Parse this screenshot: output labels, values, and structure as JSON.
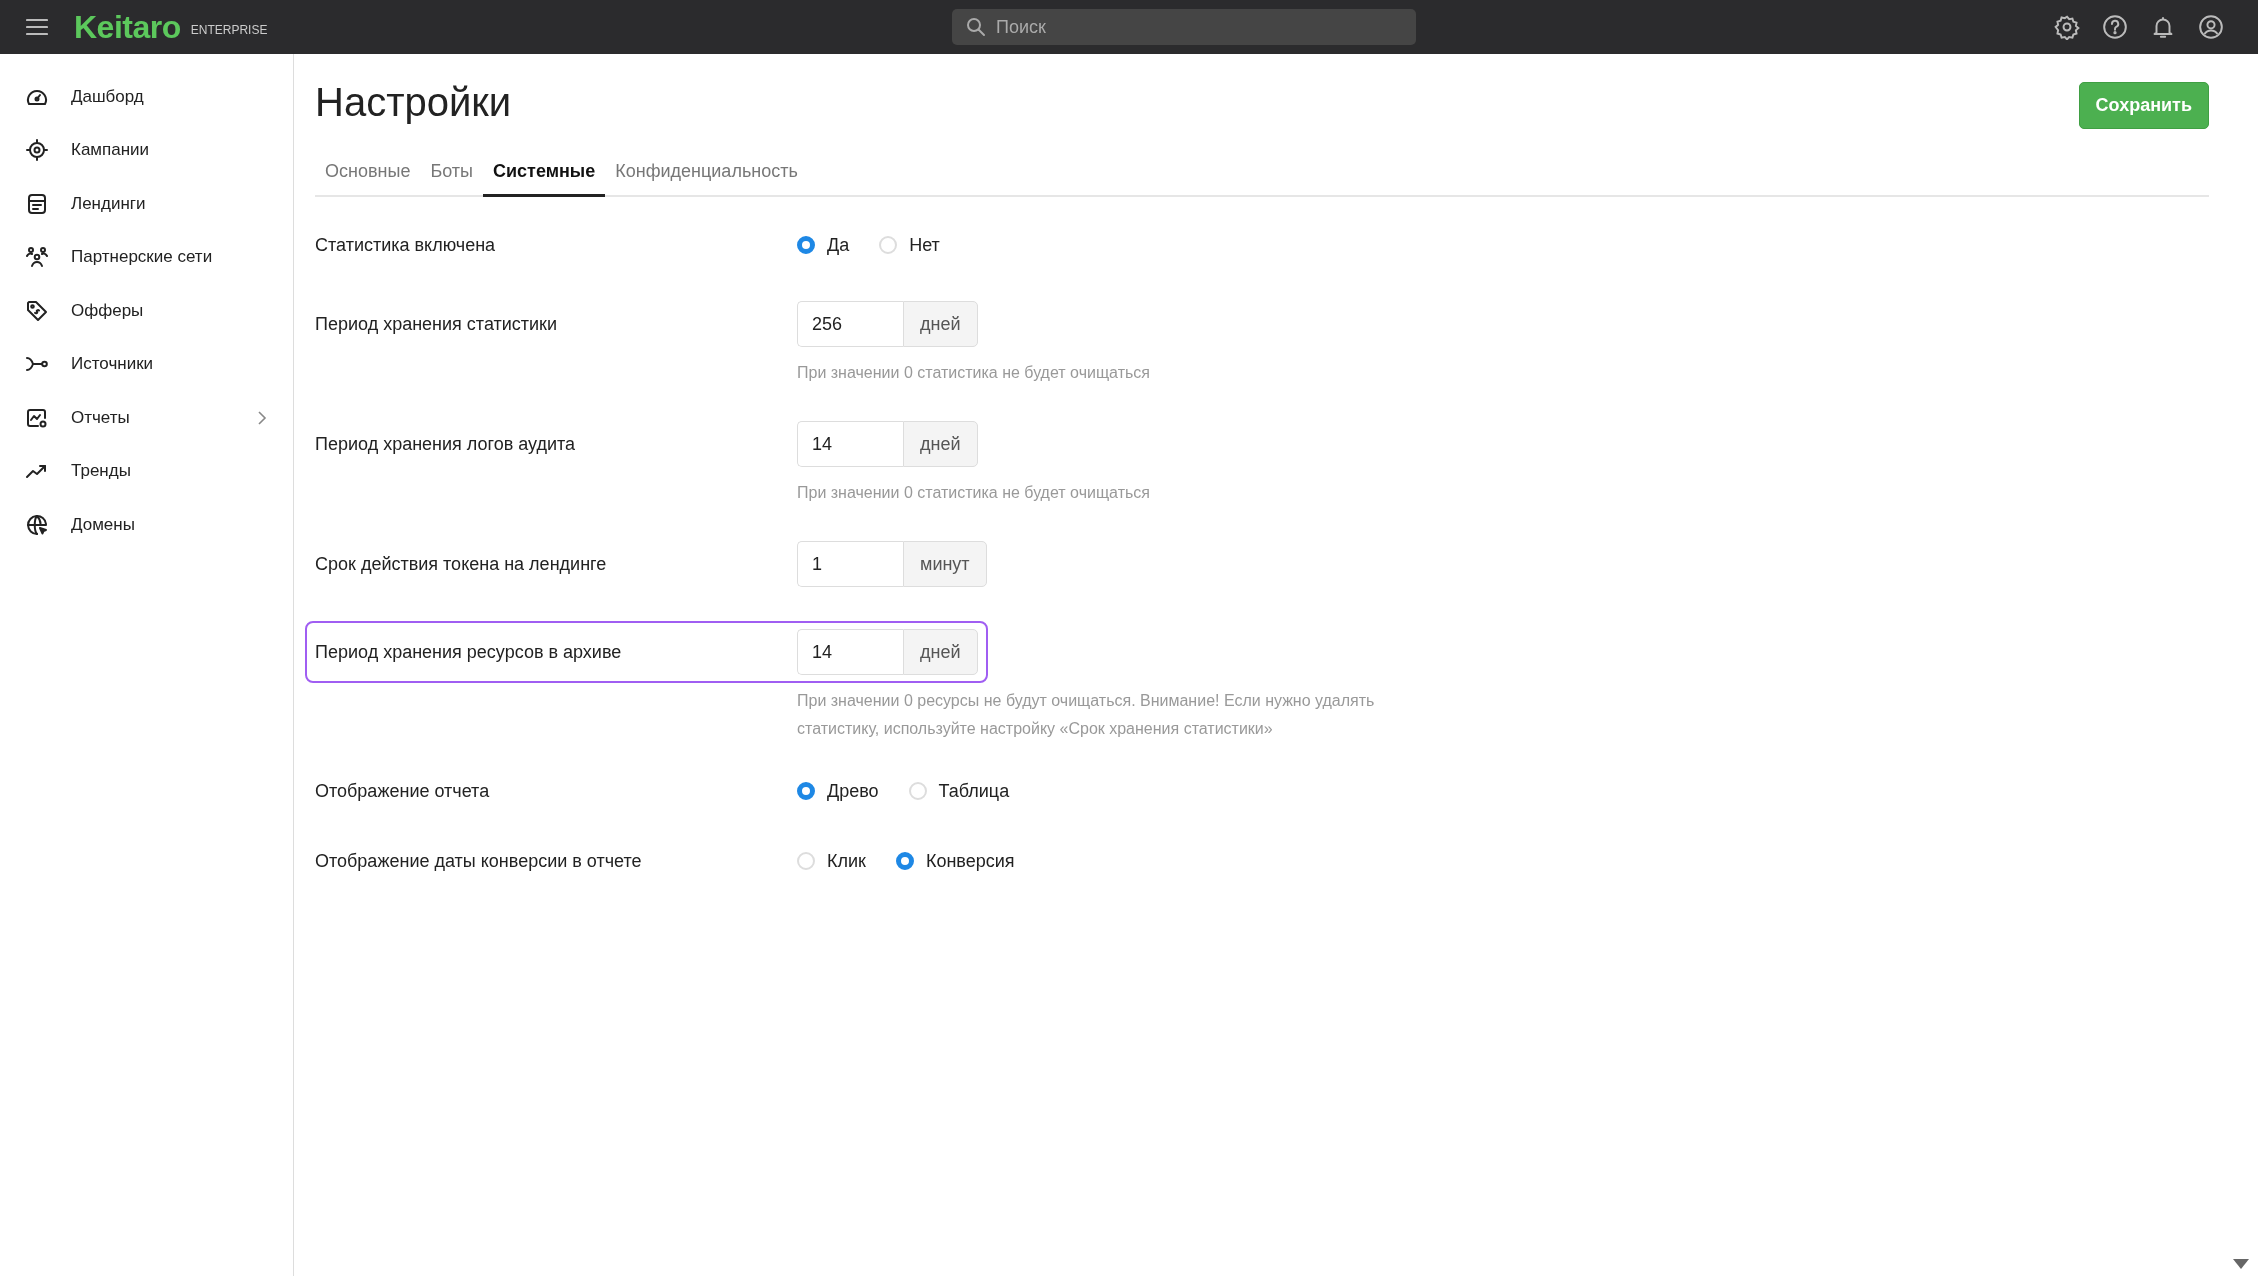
{
  "topbar": {
    "logo": "Keitaro",
    "edition": "ENTERPRISE",
    "search": {
      "placeholder": "Поиск"
    }
  },
  "sidebar": {
    "items": [
      {
        "kind": "dashboard",
        "label": "Дашборд",
        "has_submenu": false
      },
      {
        "kind": "campaigns",
        "label": "Кампании",
        "has_submenu": false
      },
      {
        "kind": "landings",
        "label": "Лендинги",
        "has_submenu": false
      },
      {
        "kind": "networks",
        "label": "Партнерские сети",
        "has_submenu": false
      },
      {
        "kind": "offers",
        "label": "Офферы",
        "has_submenu": false
      },
      {
        "kind": "sources",
        "label": "Источники",
        "has_submenu": false
      },
      {
        "kind": "reports",
        "label": "Отчеты",
        "has_submenu": true
      },
      {
        "kind": "trends",
        "label": "Тренды",
        "has_submenu": false
      },
      {
        "kind": "domains",
        "label": "Домены",
        "has_submenu": false
      }
    ]
  },
  "page": {
    "title": "Настройки",
    "save_button": "Сохранить",
    "tabs": [
      {
        "label": "Основные",
        "selected": false
      },
      {
        "label": "Боты",
        "selected": false
      },
      {
        "label": "Системные",
        "selected": true
      },
      {
        "label": "Конфиденциальность",
        "selected": false
      }
    ],
    "settings": [
      {
        "kind": "radio",
        "label": "Статистика включена",
        "highlighted": false,
        "options": [
          {
            "label": "Да",
            "selected": true
          },
          {
            "label": "Нет",
            "selected": false
          }
        ]
      },
      {
        "kind": "number",
        "label": "Период хранения статистики",
        "highlighted": false,
        "value": "256",
        "unit": "дней",
        "hint": "При значении 0 статистика не будет очищаться"
      },
      {
        "kind": "number",
        "label": "Период хранения логов аудита",
        "highlighted": false,
        "value": "14",
        "unit": "дней",
        "hint": "При значении 0 статистика не будет очищаться"
      },
      {
        "kind": "number",
        "label": "Срок действия токена на лендинге",
        "highlighted": false,
        "value": "1",
        "unit": "минут"
      },
      {
        "kind": "number",
        "label": "Период хранения ресурсов в архиве",
        "highlighted": true,
        "value": "14",
        "unit": "дней",
        "hint": "При значении 0 ресурсы не будут очищаться. Внимание! Если нужно удалять статистику, используйте настройку «Срок хранения статистики»"
      },
      {
        "kind": "radio",
        "label": "Отображение отчета",
        "highlighted": false,
        "options": [
          {
            "label": "Древо",
            "selected": true
          },
          {
            "label": "Таблица",
            "selected": false
          }
        ]
      },
      {
        "kind": "radio",
        "label": "Отображение даты конверсии в отчете",
        "highlighted": false,
        "options": [
          {
            "label": "Клик",
            "selected": false
          },
          {
            "label": "Конверсия",
            "selected": true
          }
        ]
      }
    ]
  }
}
